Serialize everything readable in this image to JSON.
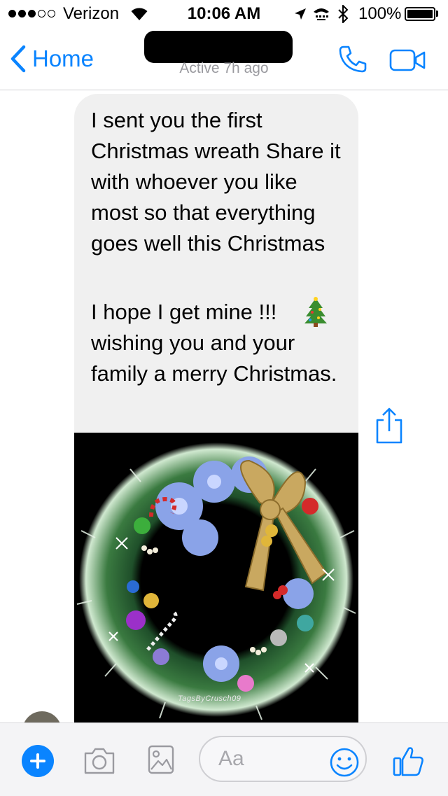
{
  "status_bar": {
    "carrier": "Verizon",
    "signal_bars_filled": 3,
    "signal_bars_total": 5,
    "time": "10:06 AM",
    "battery_percent": "100%",
    "battery_level": 1.0
  },
  "nav": {
    "back_label": "Home",
    "active_status": "Active 7h ago",
    "accent_color": "#0a84ff"
  },
  "messages": {
    "text_1": "I sent you the first Christmas wreath Share it with whoever you like most so that everything goes well this Christmas",
    "text_2": "I hope I get mine !!!  wishing you and your family a merry Christmas.",
    "emoji": "christmas-tree",
    "image_caption": "TagsByCrusch09"
  },
  "composer": {
    "placeholder": "Aa"
  },
  "icons": [
    "chevron-left-icon",
    "phone-icon",
    "video-camera-icon",
    "share-icon",
    "plus-icon",
    "camera-icon",
    "gallery-icon",
    "emoji-icon",
    "thumbs-up-icon"
  ]
}
